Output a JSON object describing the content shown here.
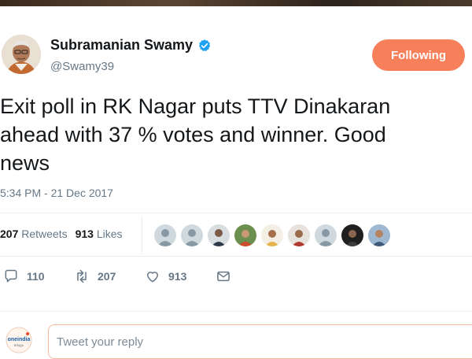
{
  "author": {
    "name": "Subramanian Swamy",
    "handle": "@Swamy39",
    "verified": true,
    "follow_label": "Following"
  },
  "tweet": {
    "text": "Exit poll in RK Nagar puts TTV Dinakaran\nahead with 37 % votes and winner. Good\nnews",
    "timestamp": "5:34 PM - 21 Dec 2017"
  },
  "stats": {
    "retweets_count": "207",
    "retweets_label": "Retweets",
    "likes_count": "913",
    "likes_label": "Likes"
  },
  "likers": [
    {
      "type": "default-avatar-icon"
    },
    {
      "type": "default-avatar-icon"
    },
    {
      "type": "photo-avatar"
    },
    {
      "type": "photo-avatar"
    },
    {
      "type": "photo-avatar"
    },
    {
      "type": "photo-avatar"
    },
    {
      "type": "default-avatar-icon"
    },
    {
      "type": "photo-avatar"
    },
    {
      "type": "photo-avatar"
    }
  ],
  "actions": {
    "reply_count": "110",
    "retweet_count": "207",
    "like_count": "913"
  },
  "reply": {
    "placeholder": "Tweet your reply"
  },
  "colors": {
    "accent": "#f7805a",
    "verified": "#1da1f2",
    "muted": "#657786"
  },
  "watermark": "oneindia telugu"
}
